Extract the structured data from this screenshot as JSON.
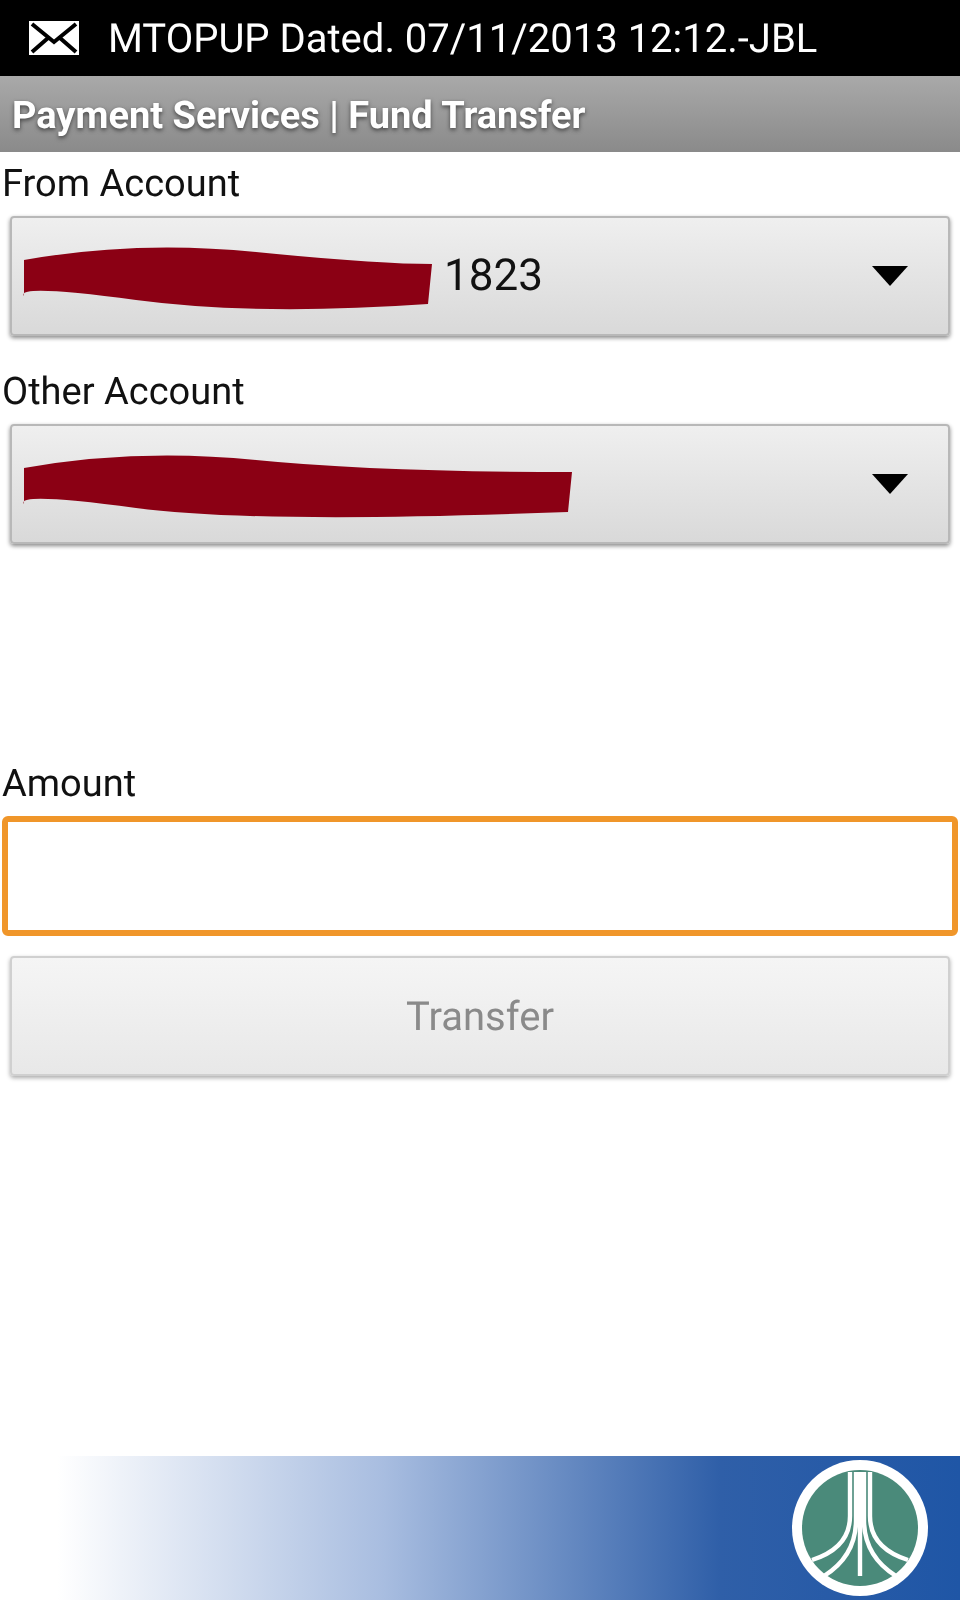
{
  "status_bar": {
    "notification": "MTOPUP Dated. 07/11/2013 12:12.-JBL"
  },
  "title_bar": {
    "title": "Payment Services | Fund Transfer"
  },
  "fields": [
    {
      "kind": "dropdown",
      "label": "From Account",
      "value": "1823",
      "redacted": true
    },
    {
      "kind": "dropdown",
      "label": "Other Account",
      "redacted": true
    },
    {
      "kind": "spacer"
    },
    {
      "kind": "input",
      "label": "Amount",
      "focused": true
    }
  ],
  "buttons": [
    {
      "label": "Transfer",
      "disabled": true
    }
  ],
  "footer": {
    "kind": "banner"
  }
}
